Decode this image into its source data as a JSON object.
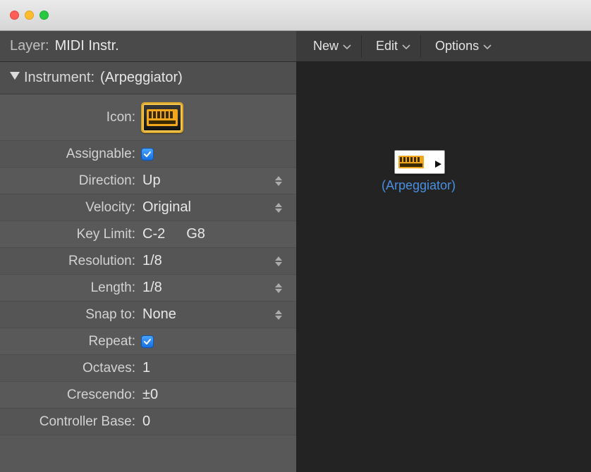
{
  "titlebar": {},
  "inspector": {
    "layer_label": "Layer:",
    "layer_value": "MIDI Instr.",
    "section_label": "Instrument:",
    "section_value": "(Arpeggiator)",
    "fields": {
      "icon_label": "Icon:",
      "assignable_label": "Assignable:",
      "assignable_checked": true,
      "direction_label": "Direction:",
      "direction_value": "Up",
      "velocity_label": "Velocity:",
      "velocity_value": "Original",
      "keylimit_label": "Key Limit:",
      "keylimit_low": "C-2",
      "keylimit_high": "G8",
      "resolution_label": "Resolution:",
      "resolution_value": "1/8",
      "length_label": "Length:",
      "length_value": "1/8",
      "snap_label": "Snap to:",
      "snap_value": "None",
      "repeat_label": "Repeat:",
      "repeat_checked": true,
      "octaves_label": "Octaves:",
      "octaves_value": "1",
      "crescendo_label": "Crescendo:",
      "crescendo_value": "±0",
      "controllerbase_label": "Controller Base:",
      "controllerbase_value": "0"
    }
  },
  "canvas": {
    "toolbar": {
      "new": "New",
      "edit": "Edit",
      "options": "Options"
    },
    "object_label": "(Arpeggiator)"
  }
}
